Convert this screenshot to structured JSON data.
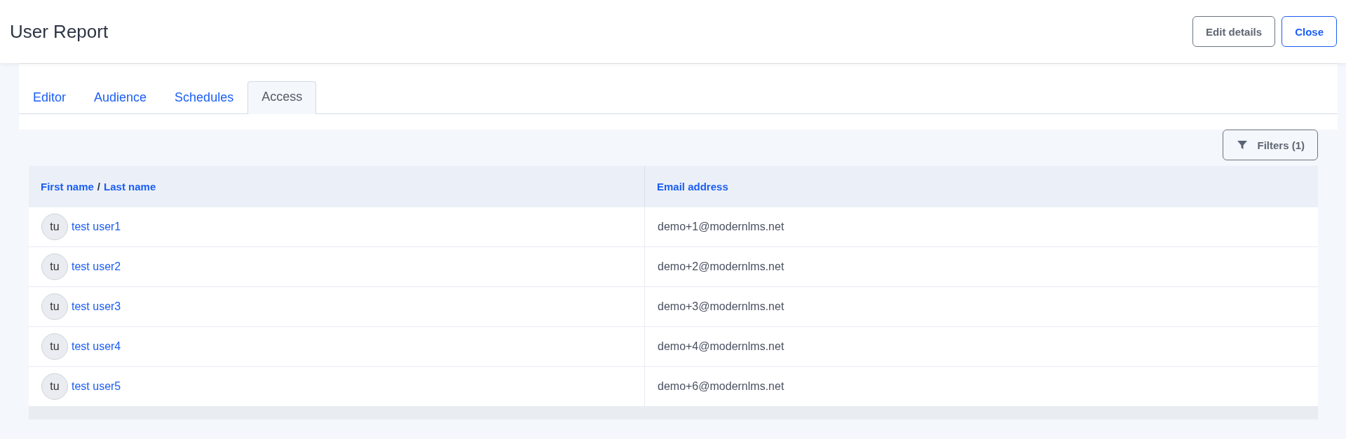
{
  "header": {
    "title": "User Report",
    "buttons": [
      {
        "label": "Edit details",
        "kind": "secondary"
      },
      {
        "label": "Close",
        "kind": "primary"
      }
    ]
  },
  "tabs": [
    {
      "label": "Editor",
      "selected": false
    },
    {
      "label": "Audience",
      "selected": false
    },
    {
      "label": "Schedules",
      "selected": false
    },
    {
      "label": "Access",
      "selected": true
    }
  ],
  "filters_button": {
    "label": "Filters (1)"
  },
  "table": {
    "columns": [
      {
        "parts": [
          {
            "text": "First name",
            "kind": "link"
          },
          {
            "text": "/",
            "kind": "separator"
          },
          {
            "text": "Last name",
            "kind": "link"
          }
        ]
      },
      {
        "parts": [
          {
            "text": "Email address",
            "kind": "link"
          }
        ]
      }
    ],
    "rows": [
      {
        "initials": "tu",
        "name": "test user1",
        "email": "demo+1@modernlms.net"
      },
      {
        "initials": "tu",
        "name": "test user2",
        "email": "demo+2@modernlms.net"
      },
      {
        "initials": "tu",
        "name": "test user3",
        "email": "demo+3@modernlms.net"
      },
      {
        "initials": "tu",
        "name": "test user4",
        "email": "demo+4@modernlms.net"
      },
      {
        "initials": "tu",
        "name": "test user5",
        "email": "demo+6@modernlms.net"
      }
    ]
  }
}
